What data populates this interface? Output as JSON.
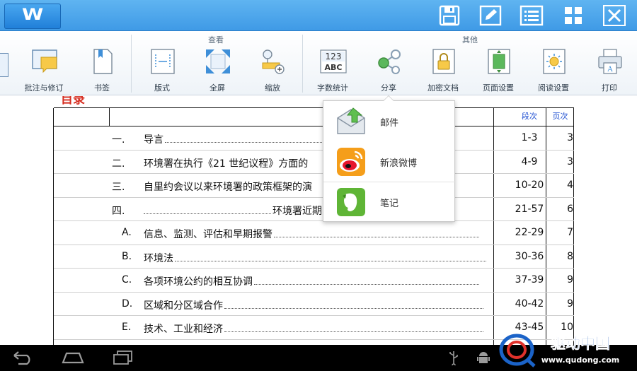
{
  "app": {
    "logo_text": "W"
  },
  "titlebar": {
    "buttons": [
      {
        "name": "save-button",
        "icon": "save-icon"
      },
      {
        "name": "edit-button",
        "icon": "pencil-icon"
      },
      {
        "name": "list-button",
        "icon": "list-icon"
      },
      {
        "name": "grid-button",
        "icon": "grid-icon"
      },
      {
        "name": "close-button",
        "icon": "close-icon"
      }
    ]
  },
  "ribbon": {
    "groups": {
      "view": "查看",
      "other": "其他"
    },
    "buttons": [
      {
        "id": "annotate",
        "label": "批注与修订",
        "icon": "comment-icon"
      },
      {
        "id": "bookmark",
        "label": "书签",
        "icon": "bookmark-icon"
      },
      {
        "id": "layout",
        "label": "版式",
        "icon": "layout-icon"
      },
      {
        "id": "fullscreen",
        "label": "全屏",
        "icon": "fullscreen-icon"
      },
      {
        "id": "zoom",
        "label": "缩放",
        "icon": "zoom-icon"
      },
      {
        "id": "wordcount",
        "label": "字数统计",
        "icon": "wordcount-icon"
      },
      {
        "id": "share",
        "label": "分享",
        "icon": "share-icon"
      },
      {
        "id": "encrypt",
        "label": "加密文档",
        "icon": "lock-icon"
      },
      {
        "id": "pagesetup",
        "label": "页面设置",
        "icon": "page-setup-icon"
      },
      {
        "id": "readsettings",
        "label": "阅读设置",
        "icon": "reading-settings-icon"
      },
      {
        "id": "print",
        "label": "打印",
        "icon": "printer-icon"
      }
    ],
    "wordcount_icon_text": {
      "top": "123",
      "bottom": "ABC"
    }
  },
  "document": {
    "heading_fragment": "目录",
    "header": {
      "para": "段次",
      "page": "页次"
    },
    "rows": [
      {
        "num": "一.",
        "title": "导言",
        "para": "1-3",
        "page": "3"
      },
      {
        "num": "二.",
        "title": "环境署在执行《21 世纪议程》方面的",
        "para": "4-9",
        "page": "3"
      },
      {
        "num": "三.",
        "title": "自里约会议以来环境署的政策框架的演",
        "para": "10-20",
        "page": "4"
      },
      {
        "num": "四.",
        "title": "环境署近期",
        "para": "21-57",
        "page": "6"
      },
      {
        "num": "A.",
        "title": "信息、监测、评估和早期报警",
        "para": "22-29",
        "page": "7"
      },
      {
        "num": "B.",
        "title": "环境法",
        "para": "30-36",
        "page": "8"
      },
      {
        "num": "C.",
        "title": "各项环境公约的相互协调",
        "para": "37-39",
        "page": "9"
      },
      {
        "num": "D.",
        "title": "区域和分区域合作",
        "para": "40-42",
        "page": "9"
      },
      {
        "num": "E.",
        "title": "技术、工业和经济",
        "para": "43-45",
        "page": "10"
      }
    ]
  },
  "share_menu": {
    "items": [
      {
        "label": "邮件",
        "icon": "mail-icon"
      },
      {
        "label": "新浪微博",
        "icon": "weibo-icon"
      },
      {
        "label": "笔记",
        "icon": "evernote-icon"
      }
    ]
  },
  "watermark": {
    "brand": "驱动中国",
    "url": "www.qudong.com"
  },
  "colors": {
    "titlebar": "#3f9ae6",
    "accent_red": "#d62d20",
    "header_blue": "#1f4fd1"
  }
}
